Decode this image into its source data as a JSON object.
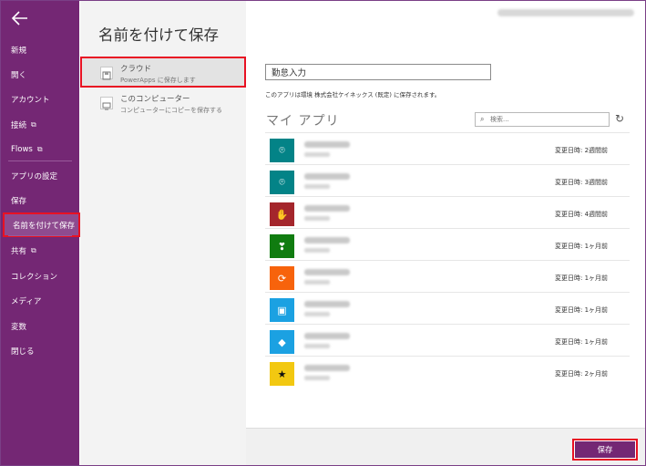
{
  "sidebar": {
    "items": [
      {
        "label": "新規",
        "external": false
      },
      {
        "label": "開く",
        "external": false
      },
      {
        "label": "アカウント",
        "external": false
      },
      {
        "label": "接続",
        "external": true
      },
      {
        "label": "Flows",
        "external": true
      },
      {
        "label": "アプリの設定",
        "external": false
      },
      {
        "label": "保存",
        "external": false
      },
      {
        "label": "名前を付けて保存",
        "external": false,
        "active": true
      },
      {
        "label": "共有",
        "external": true
      },
      {
        "label": "コレクション",
        "external": false
      },
      {
        "label": "メディア",
        "external": false
      },
      {
        "label": "変数",
        "external": false
      },
      {
        "label": "閉じる",
        "external": false
      }
    ],
    "external_icon": "external-link-icon",
    "accent_color": "#742774"
  },
  "page": {
    "title": "名前を付けて保存"
  },
  "locations": {
    "cloud": {
      "title": "クラウド",
      "subtitle": "PowerApps に保存します",
      "icon": "cloud-save-icon"
    },
    "pc": {
      "title": "このコンピューター",
      "subtitle": "コンピューターにコピーを保存する",
      "icon": "computer-icon"
    }
  },
  "main": {
    "app_name_value": "勤怠入力",
    "save_note": "このアプリは環境 株式会社ケイネックス (既定) に保存されます。",
    "section_title": "マイ アプリ",
    "search_placeholder": "検索...",
    "search_icon": "search-icon",
    "refresh_icon": "refresh-icon"
  },
  "apps": [
    {
      "icon": "map-pin-icon",
      "color": "#038387",
      "modified": "変更日時: 2週間前"
    },
    {
      "icon": "map-pin-icon",
      "color": "#038387",
      "modified": "変更日時: 3週間前"
    },
    {
      "icon": "thumbs-icon",
      "color": "#a4262c",
      "modified": "変更日時: 4週間前"
    },
    {
      "icon": "heart-down-icon",
      "color": "#107c10",
      "modified": "変更日時: 1ヶ月前"
    },
    {
      "icon": "sync-icon",
      "color": "#f7630c",
      "modified": "変更日時: 1ヶ月前"
    },
    {
      "icon": "screen-icon",
      "color": "#1ba1e2",
      "modified": "変更日時: 1ヶ月前"
    },
    {
      "icon": "diamonds-icon",
      "color": "#1ba1e2",
      "modified": "変更日時: 1ヶ月前"
    },
    {
      "icon": "star-icon",
      "color": "#f2c811",
      "modified": "変更日時: 2ヶ月前"
    }
  ],
  "footer": {
    "save_label": "保存"
  }
}
